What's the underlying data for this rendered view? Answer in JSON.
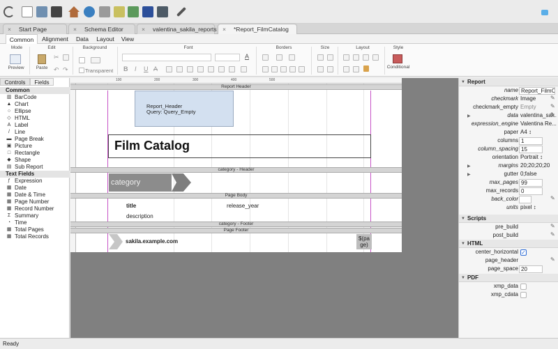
{
  "doc_tabs": [
    {
      "label": "Start Page",
      "active": false
    },
    {
      "label": "Schema Editor",
      "active": false
    },
    {
      "label": "valentina_sakila_reports",
      "active": false
    },
    {
      "label": "*Report_FilmCatalog",
      "active": true
    }
  ],
  "ribbon_tabs": [
    "Common",
    "Alignment",
    "Data",
    "Layout",
    "View"
  ],
  "ribbon": {
    "mode": "Mode",
    "preview": "Preview",
    "edit": "Edit",
    "paste": "Paste",
    "background": "Background",
    "transparent": "Transparent",
    "font": "Font",
    "borders": "Borders",
    "size": "Size",
    "layout": "Layout",
    "style": "Style",
    "conditional": "Conditional"
  },
  "left_tabs": [
    "Controls",
    "Fields"
  ],
  "left_common_title": "Common",
  "left_common": [
    "BarCode",
    "Chart",
    "Ellipse",
    "HTML",
    "Label",
    "Line",
    "Page Break",
    "Picture",
    "Rectangle",
    "Shape",
    "Sub Report"
  ],
  "left_text_title": "Text Fields",
  "left_text": [
    "Expression",
    "Date",
    "Date & Time",
    "Page Number",
    "Record Number",
    "Summary",
    "Time",
    "Total Pages",
    "Total Records"
  ],
  "ruler": [
    "100",
    "200",
    "300",
    "400",
    "500"
  ],
  "bands": {
    "report_header": "Report Header",
    "category_header": "category - Header",
    "page_body": "Page Body",
    "category_footer": "category - Footer",
    "page_footer": "Page Footer"
  },
  "canvas": {
    "query_box_line1": "Report_Header",
    "query_box_line2": "Query: Query_Empty",
    "title": "Film Catalog",
    "category": "category",
    "field_title": "title",
    "field_release_year": "release_year",
    "field_description": "description",
    "footer_url": "sakila.example.com",
    "footer_page_1": "$(pa",
    "footer_page_2": "ge)"
  },
  "properties": {
    "report_section": "Report",
    "rows": [
      {
        "label": "name",
        "italic": true,
        "value": "Report_FilmCat",
        "input": true,
        "pencil": false
      },
      {
        "label": "checkmark",
        "italic": true,
        "value": "Image",
        "input": false,
        "pencil": true
      },
      {
        "label": "checkmark_empty",
        "italic": false,
        "value": "Empty",
        "input": false,
        "pencil": true
      },
      {
        "label": "data",
        "italic": true,
        "value": "valentina_sak...",
        "input": false,
        "pencil": true,
        "expand": true
      },
      {
        "label": "expression_engine",
        "italic": true,
        "value": "Valentina Re...",
        "input": false,
        "pencil": false
      },
      {
        "label": "paper",
        "italic": false,
        "value": "A4 ↕",
        "input": false,
        "pencil": false
      },
      {
        "label": "columns",
        "italic": false,
        "value": "1",
        "input": true,
        "pencil": false
      },
      {
        "label": "column_spacing",
        "italic": true,
        "value": "15",
        "input": true,
        "pencil": false
      },
      {
        "label": "orientation",
        "italic": false,
        "value": "Portrait ↕",
        "input": false,
        "pencil": false
      },
      {
        "label": "margins",
        "italic": true,
        "value": "20;20;20;20",
        "input": false,
        "pencil": false,
        "expand": true
      },
      {
        "label": "gutter",
        "italic": false,
        "value": "0;false",
        "input": false,
        "pencil": false,
        "expand": true
      },
      {
        "label": "max_pages",
        "italic": true,
        "value": "99",
        "input": true,
        "pencil": false
      },
      {
        "label": "max_records",
        "italic": false,
        "value": "0",
        "input": true,
        "pencil": false
      },
      {
        "label": "back_color",
        "italic": true,
        "value": "",
        "input": true,
        "pencil": true
      },
      {
        "label": "units",
        "italic": true,
        "value": "pixel ↕",
        "input": false,
        "pencil": false
      }
    ],
    "scripts_section": "Scripts",
    "scripts": [
      "pre_build",
      "post_build"
    ],
    "html_section": "HTML",
    "center_horizontal": "center_horizontal",
    "page_header": "page_header",
    "page_space": "page_space",
    "page_space_value": "20",
    "pdf_section": "PDF",
    "xmp_data": "xmp_data",
    "xmp_cdata": "xmp_cdata"
  },
  "status": "Ready",
  "colors": {
    "accent": "#2a6ad6",
    "band": "#d4d4d4",
    "category_bg": "#8c8c8c",
    "query_box": "#d3e0f0",
    "margin_line": "#c653c6"
  }
}
